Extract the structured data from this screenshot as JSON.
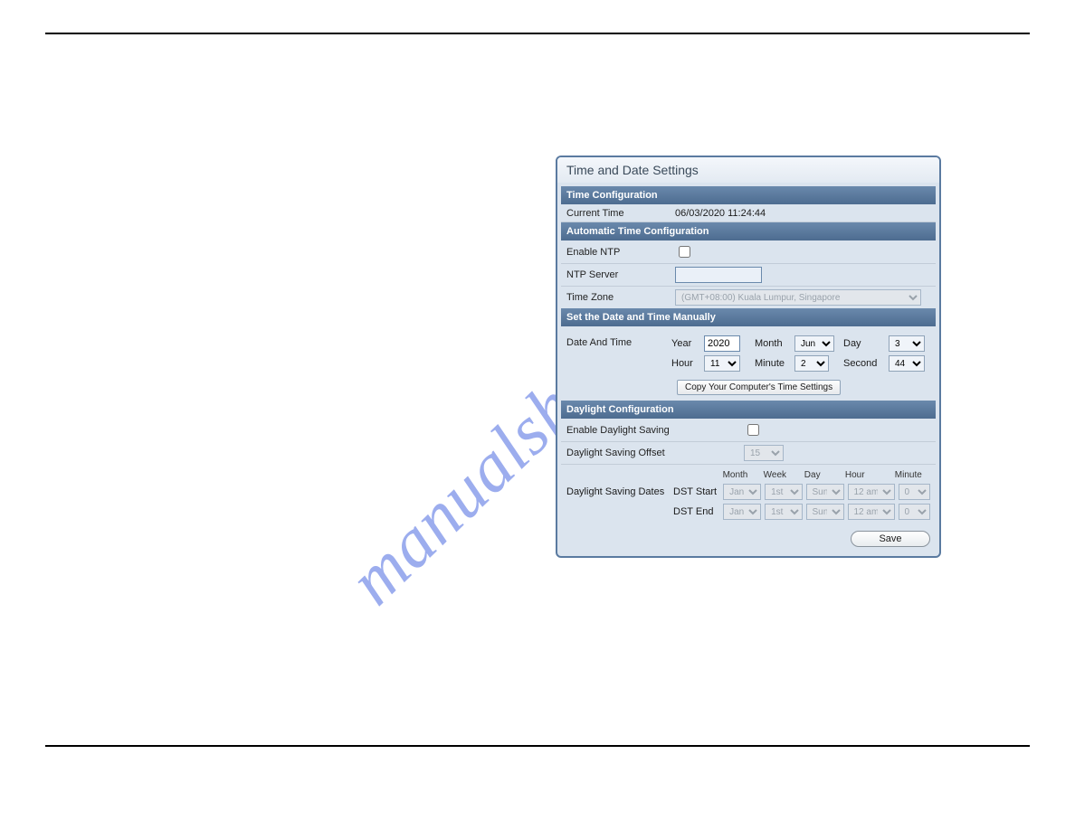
{
  "watermark": "manualshive.com",
  "panel": {
    "title": "Time and Date Settings",
    "save_label": "Save"
  },
  "time_config": {
    "header": "Time Configuration",
    "current_time_label": "Current Time",
    "current_time_value": "06/03/2020 11:24:44"
  },
  "auto_time": {
    "header": "Automatic Time Configuration",
    "enable_ntp_label": "Enable NTP",
    "ntp_server_label": "NTP Server",
    "ntp_server_value": "",
    "timezone_label": "Time Zone",
    "timezone_value": "(GMT+08:00) Kuala Lumpur, Singapore"
  },
  "manual_time": {
    "header": "Set the Date and Time Manually",
    "row_label": "Date And Time",
    "year_label": "Year",
    "year_value": "2020",
    "month_label": "Month",
    "month_value": "Jun",
    "day_label": "Day",
    "day_value": "3",
    "hour_label": "Hour",
    "hour_value": "11",
    "minute_label": "Minute",
    "minute_value": "2",
    "second_label": "Second",
    "second_value": "44",
    "copy_button": "Copy Your Computer's Time Settings"
  },
  "daylight": {
    "header": "Daylight Configuration",
    "enable_label": "Enable Daylight Saving",
    "offset_label": "Daylight Saving Offset",
    "offset_value": "15",
    "dates_label": "Daylight Saving Dates",
    "col_month": "Month",
    "col_week": "Week",
    "col_day": "Day",
    "col_hour": "Hour",
    "col_minute": "Minute",
    "dst_start_label": "DST Start",
    "dst_end_label": "DST End",
    "v_month": "Jan",
    "v_week": "1st",
    "v_day": "Sun",
    "v_hour": "12 am",
    "v_minute": "0"
  }
}
